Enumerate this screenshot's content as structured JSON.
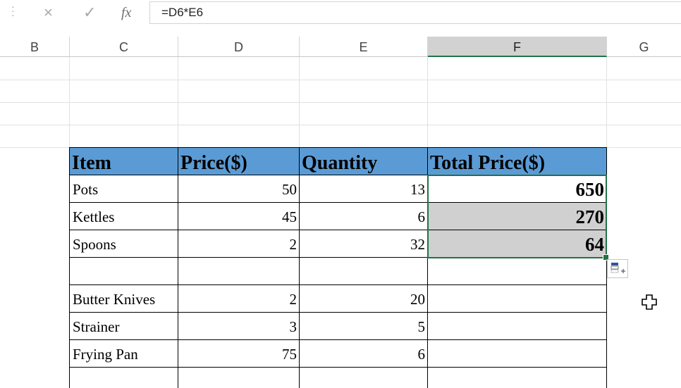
{
  "formula_bar": {
    "cancel_icon": "×",
    "enter_icon": "✓",
    "fx_label": "fx",
    "formula": "=D6*E6"
  },
  "columns": [
    "B",
    "C",
    "D",
    "E",
    "F",
    "G"
  ],
  "selected_column": "F",
  "table": {
    "headers": [
      "Item",
      "Price($)",
      "Quantity",
      "Total Price($)"
    ],
    "rows": [
      {
        "item": "Pots",
        "price": "50",
        "quantity": "13",
        "total": "650"
      },
      {
        "item": "Kettles",
        "price": "45",
        "quantity": "6",
        "total": "270"
      },
      {
        "item": "Spoons",
        "price": "2",
        "quantity": "32",
        "total": "64"
      },
      {
        "item": "",
        "price": "",
        "quantity": "",
        "total": ""
      },
      {
        "item": "Butter Knives",
        "price": "2",
        "quantity": "20",
        "total": ""
      },
      {
        "item": "Strainer",
        "price": "3",
        "quantity": "5",
        "total": ""
      },
      {
        "item": "Frying Pan",
        "price": "75",
        "quantity": "6",
        "total": ""
      }
    ]
  },
  "colors": {
    "header_fill": "#5b9bd5",
    "selection_border": "#217346",
    "shaded_fill": "#d0d0d0"
  },
  "icons": {
    "quick_analysis": "quick-analysis-icon",
    "cursor": "cell-cursor-icon"
  }
}
